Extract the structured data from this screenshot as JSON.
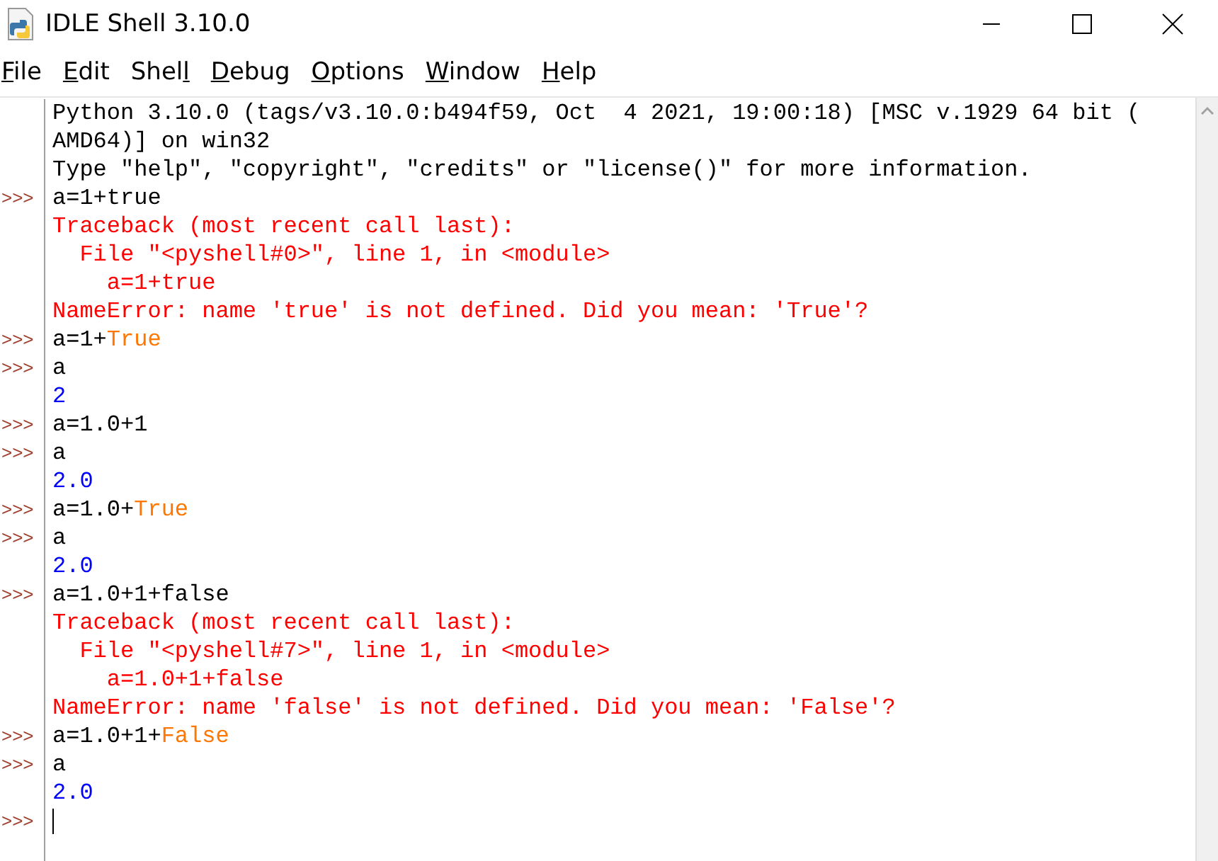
{
  "window": {
    "title": "IDLE Shell 3.10.0"
  },
  "menu": [
    {
      "key": "F",
      "after": "ile"
    },
    {
      "key": "E",
      "after": "dit"
    },
    {
      "before": "Shel",
      "key": "l"
    },
    {
      "key": "D",
      "after": "ebug"
    },
    {
      "key": "O",
      "after": "ptions"
    },
    {
      "key": "W",
      "after": "indow"
    },
    {
      "key": "H",
      "after": "elp"
    }
  ],
  "lines": [
    {
      "segments": [
        {
          "kind": "stdout",
          "text": "Python 3.10.0 (tags/v3.10.0:b494f59, Oct  4 2021, 19:00:18) [MSC v.1929 64 bit ("
        }
      ]
    },
    {
      "segments": [
        {
          "kind": "stdout",
          "text": "AMD64)] on win32"
        }
      ]
    },
    {
      "segments": [
        {
          "kind": "stdout",
          "text": "Type \"help\", \"copyright\", \"credits\" or \"license()\" for more information."
        }
      ]
    },
    {
      "prompt": ">>>",
      "segments": [
        {
          "kind": "input",
          "text": "a=1+true"
        }
      ]
    },
    {
      "segments": [
        {
          "kind": "error",
          "text": "Traceback (most recent call last):"
        }
      ]
    },
    {
      "segments": [
        {
          "kind": "error",
          "text": "  File \"<pyshell#0>\", line 1, in <module>"
        }
      ]
    },
    {
      "segments": [
        {
          "kind": "error",
          "text": "    a=1+true"
        }
      ]
    },
    {
      "segments": [
        {
          "kind": "error",
          "text": "NameError: name 'true' is not defined. Did you mean: 'True'?"
        }
      ]
    },
    {
      "prompt": ">>>",
      "segments": [
        {
          "kind": "input",
          "text": "a=1+"
        },
        {
          "kind": "builtin",
          "text": "True"
        }
      ]
    },
    {
      "prompt": ">>>",
      "segments": [
        {
          "kind": "input",
          "text": "a"
        }
      ]
    },
    {
      "segments": [
        {
          "kind": "output",
          "text": "2"
        }
      ]
    },
    {
      "prompt": ">>>",
      "segments": [
        {
          "kind": "input",
          "text": "a=1.0+1"
        }
      ]
    },
    {
      "prompt": ">>>",
      "segments": [
        {
          "kind": "input",
          "text": "a"
        }
      ]
    },
    {
      "segments": [
        {
          "kind": "output",
          "text": "2.0"
        }
      ]
    },
    {
      "prompt": ">>>",
      "segments": [
        {
          "kind": "input",
          "text": "a=1.0+"
        },
        {
          "kind": "builtin",
          "text": "True"
        }
      ]
    },
    {
      "prompt": ">>>",
      "segments": [
        {
          "kind": "input",
          "text": "a"
        }
      ]
    },
    {
      "segments": [
        {
          "kind": "output",
          "text": "2.0"
        }
      ]
    },
    {
      "prompt": ">>>",
      "segments": [
        {
          "kind": "input",
          "text": "a=1.0+1+false"
        }
      ]
    },
    {
      "segments": [
        {
          "kind": "error",
          "text": "Traceback (most recent call last):"
        }
      ]
    },
    {
      "segments": [
        {
          "kind": "error",
          "text": "  File \"<pyshell#7>\", line 1, in <module>"
        }
      ]
    },
    {
      "segments": [
        {
          "kind": "error",
          "text": "    a=1.0+1+false"
        }
      ]
    },
    {
      "segments": [
        {
          "kind": "error",
          "text": "NameError: name 'false' is not defined. Did you mean: 'False'?"
        }
      ]
    },
    {
      "prompt": ">>>",
      "segments": [
        {
          "kind": "input",
          "text": "a=1.0+1+"
        },
        {
          "kind": "builtin",
          "text": "False"
        }
      ]
    },
    {
      "prompt": ">>>",
      "segments": [
        {
          "kind": "input",
          "text": "a"
        }
      ]
    },
    {
      "segments": [
        {
          "kind": "output",
          "text": "2.0"
        }
      ]
    },
    {
      "prompt": ">>>",
      "cursor": true
    }
  ]
}
